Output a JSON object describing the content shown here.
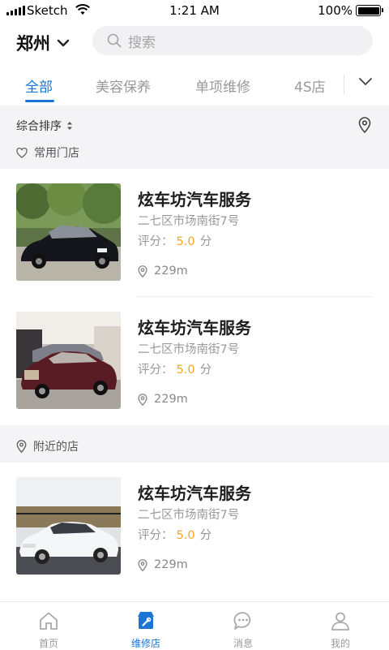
{
  "status_bar": {
    "carrier": "Sketch",
    "time": "1:21 AM",
    "battery": "100%"
  },
  "header": {
    "city": "郑州",
    "search_placeholder": "搜索"
  },
  "tabs": [
    {
      "label": "全部",
      "active": true
    },
    {
      "label": "美容保养",
      "active": false
    },
    {
      "label": "单项维修",
      "active": false
    },
    {
      "label": "4S店",
      "active": false
    }
  ],
  "filter": {
    "sort_label": "综合排序"
  },
  "sections": {
    "favorites": "常用门店",
    "nearby": "附近的店"
  },
  "shops": [
    {
      "name": "炫车坊汽车服务",
      "address": "二七区市场南街7号",
      "rating_label": "评分：",
      "rating": "5.0",
      "rating_unit": "分",
      "distance": "229m"
    },
    {
      "name": "炫车坊汽车服务",
      "address": "二七区市场南街7号",
      "rating_label": "评分：",
      "rating": "5.0",
      "rating_unit": "分",
      "distance": "229m"
    },
    {
      "name": "炫车坊汽车服务",
      "address": "二七区市场南街7号",
      "rating_label": "评分：",
      "rating": "5.0",
      "rating_unit": "分",
      "distance": "229m"
    }
  ],
  "bottom_nav": [
    {
      "label": "首页",
      "icon": "home-icon",
      "active": false
    },
    {
      "label": "维修店",
      "icon": "store-icon",
      "active": true
    },
    {
      "label": "消息",
      "icon": "chat-icon",
      "active": false
    },
    {
      "label": "我的",
      "icon": "user-icon",
      "active": false
    }
  ],
  "colors": {
    "accent": "#1a76d2",
    "rating": "#f5a623",
    "band": "#f4f4f6"
  }
}
